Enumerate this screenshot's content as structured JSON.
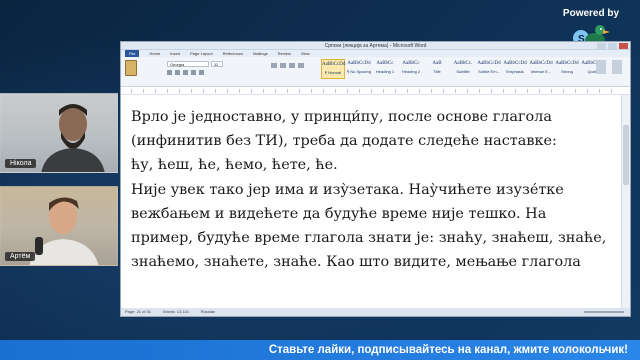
{
  "powered": {
    "label": "Powered by"
  },
  "participants": [
    {
      "name": "Нікола"
    },
    {
      "name": "Артём"
    }
  ],
  "word": {
    "title": "Српски (лекција за Артема) - Microsoft Word",
    "tabs": [
      "File",
      "Home",
      "Insert",
      "Page Layout",
      "References",
      "Mailings",
      "Review",
      "View"
    ],
    "font_name": "Georgia",
    "font_size": "11",
    "styles": [
      {
        "sample": "AaBbCcDd",
        "label": "¶ Normal"
      },
      {
        "sample": "AaBbCcDd",
        "label": "¶ No Spacing"
      },
      {
        "sample": "AaBbCc",
        "label": "Heading 1"
      },
      {
        "sample": "AaBbCc",
        "label": "Heading 2"
      },
      {
        "sample": "AaB",
        "label": "Title"
      },
      {
        "sample": "AaBbCc.",
        "label": "Subtitle"
      },
      {
        "sample": "AaBbCcDd",
        "label": "Subtle Em..."
      },
      {
        "sample": "AaBbCcDd",
        "label": "Emphasis"
      },
      {
        "sample": "AaBbCcDd",
        "label": "Intense E..."
      },
      {
        "sample": "AaBbCcDd",
        "label": "Strong"
      },
      {
        "sample": "AaBbCcDd",
        "label": "Quote"
      }
    ],
    "doc_lines": [
      "Врло је једноставно, у принци́пу, после основе глагола",
      "(инфинитив без ТИ), треба да додате следеће наставке:",
      "ћу, ћеш, ће, ћемо, ћете, ће.",
      "Није увек тако јер има и изу̀зетака. Нау̀чићете изузе́тке",
      "вежбањем и видећете да будуће време није тешко. На",
      "пример, будуће време глагола знати је: знаћу, знаћеш, знаће,",
      "знаћемо, знаћете, знаће.  Као што видите, мењање глагола"
    ],
    "status": {
      "page": "Page: 21 of 31",
      "words": "Words: 13,116",
      "lang": "Russian"
    }
  },
  "banner": {
    "text": "Ставьте лайки, подписывайтесь на канал, жмите колокольчик!"
  }
}
